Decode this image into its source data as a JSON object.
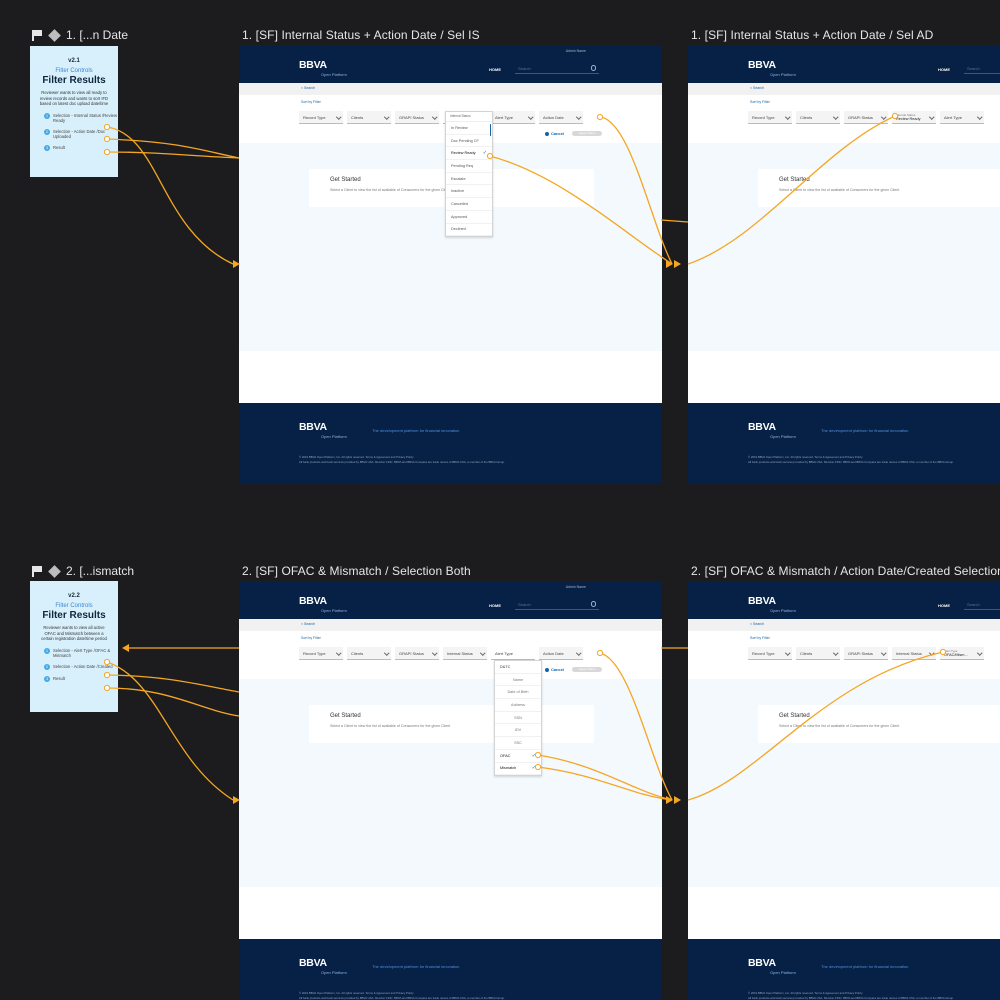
{
  "flows": [
    {
      "title": "1. [...n Date",
      "card": {
        "version": "v2.1",
        "subtitle": "Filter Controls",
        "title": "Filter Results",
        "description": "Reviewer wants to view all ready to review records and wants to sort IFD based on latest doc upload date/time",
        "steps": [
          {
            "num": "1",
            "label": "Selection - Internal Status /Review Ready"
          },
          {
            "num": "2",
            "label": "Selection - Action Date /Doc Uploaded"
          },
          {
            "num": "3",
            "label": "Result"
          }
        ]
      }
    },
    {
      "title": "2. [...ismatch",
      "card": {
        "version": "v2.2",
        "subtitle": "Filter Controls",
        "title": "Filter Results",
        "description": "Reviewer wants to view all active OFAC and Mismatch between a certain registration date/time period",
        "steps": [
          {
            "num": "1",
            "label": "Selection - Alert Type /OFAC & Mismatch"
          },
          {
            "num": "2",
            "label": "Selection - Action Date /Created"
          },
          {
            "num": "3",
            "label": "Result"
          }
        ]
      }
    }
  ],
  "screens": [
    {
      "title": "1. [SF] Internal Status + Action Date / Sel IS"
    },
    {
      "title": "1. [SF] Internal Status + Action Date / Sel AD"
    },
    {
      "title": "2. [SF] OFAC & Mismatch / Selection Both"
    },
    {
      "title": "2. [SF] OFAC & Mismatch / Action Date/Created Selection"
    }
  ],
  "app": {
    "user_name": "Admin Name",
    "logo": "BBVA",
    "logo_sub": "Open Platform",
    "nav_home": "HOME",
    "search_placeholder": "Search",
    "breadcrumb": "< Search",
    "sort_by": "Sort by Filter",
    "filters": {
      "record_type": "Record Type",
      "clients": "Clients",
      "grapi_status": "GRAPI Status",
      "internal_status": "Internal Status",
      "alert_type": "Alert Type",
      "action_date": "Action Date"
    },
    "selected": {
      "internal_status_label": "Internal Status",
      "internal_status_value": "Review Ready",
      "alert_type_label": "Alert Type",
      "alert_type_value": "OFAC/Mism..."
    },
    "cancel": "Cancel",
    "apply": "Apply Filters",
    "get_started_title": "Get Started",
    "get_started_text": "Select a Client to view the list of available of Consumers for the given Client",
    "footer_tagline": "The development platform for financial innovation",
    "footer_copy": "© 2019 BBVA Open Platform, Inc. All rights reserved. Terms & Agreement and Privacy Policy",
    "footer_copy2": "All bank products and bank services provided by BBVA USA. Member FDIC. BBVA and BBVA Compass are trade names of BBVA USA, a member of the BBVA Group."
  },
  "internal_status_dropdown": {
    "header": "Internal Status",
    "items": [
      "In Review",
      "Doc Pending CF",
      "Review Ready",
      "Pending Req",
      "Escalate",
      "Inactive",
      "Cancelled",
      "Approved",
      "Declined"
    ],
    "checked": "Review Ready"
  },
  "alert_type_dropdown": {
    "header": "Alert Type",
    "group": "D&TC",
    "items": [
      "Name",
      "Date of Birth",
      "Address",
      "SSN",
      "IDV",
      "SSC"
    ],
    "checked_items": [
      "OFAC",
      "Mismatch"
    ]
  },
  "colors": {
    "connector": "#f5a623",
    "header_navy": "#072146",
    "card_bg": "#d8f0fc",
    "link_blue": "#1464a5"
  }
}
